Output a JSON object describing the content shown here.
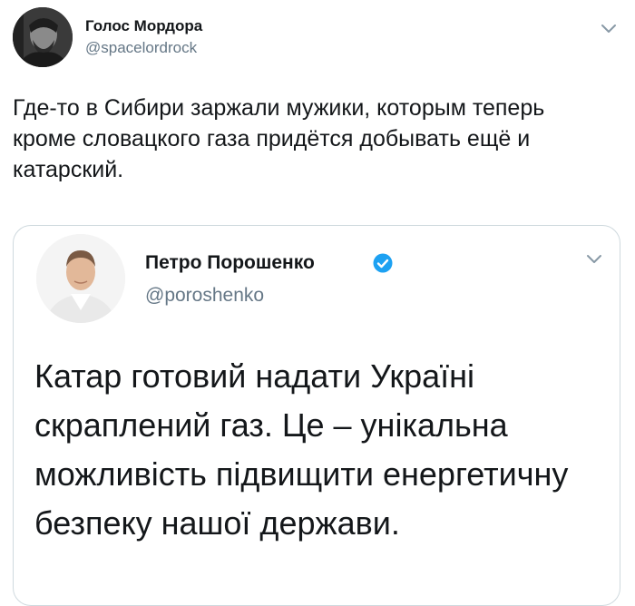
{
  "tweet": {
    "author_name": "Голос Мордора",
    "author_handle": "@spacelordrock",
    "text": "Где-то в Сибири заржали мужики, которым теперь кроме словацкого газа придётся добывать ещё и катарский."
  },
  "quoted_tweet": {
    "author_name": "Петро Порошенко",
    "author_handle": "@poroshenko",
    "verified": true,
    "text": "Катар готовий надати Україні скраплений газ. Це – унікальна можливість підвищити енергетичну безпеку нашої держави."
  },
  "icons": {
    "menu": "chevron-down-icon",
    "verified": "verified-badge-icon"
  },
  "colors": {
    "text": "#14171a",
    "secondary_text": "#657786",
    "verified_blue": "#1da1f2",
    "card_border": "#cfd9de"
  }
}
